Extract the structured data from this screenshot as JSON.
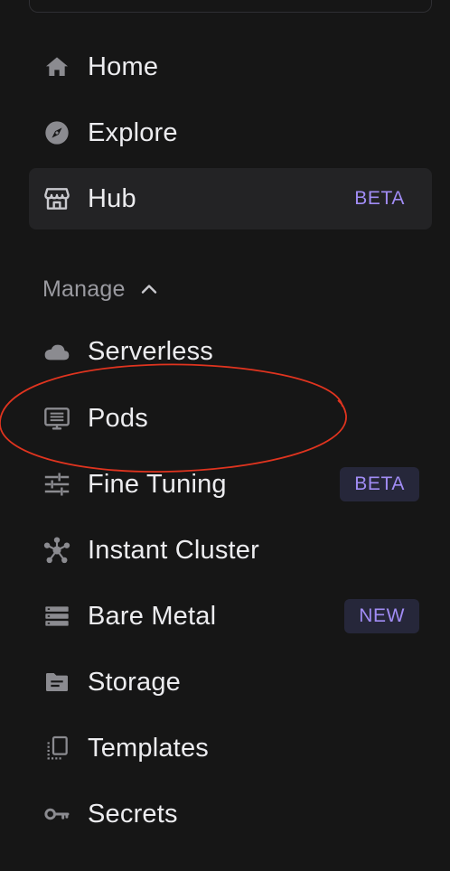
{
  "nav": {
    "home": {
      "label": "Home",
      "icon": "home-icon"
    },
    "explore": {
      "label": "Explore",
      "icon": "compass-icon"
    },
    "hub": {
      "label": "Hub",
      "icon": "storefront-icon",
      "badge": "BETA"
    }
  },
  "manage": {
    "header": "Manage",
    "header_icon": "chevron-up-icon",
    "items": [
      {
        "label": "Serverless",
        "icon": "cloud-icon"
      },
      {
        "label": "Pods",
        "icon": "monitor-icon"
      },
      {
        "label": "Fine Tuning",
        "icon": "sliders-icon",
        "badge": "BETA"
      },
      {
        "label": "Instant Cluster",
        "icon": "cluster-icon"
      },
      {
        "label": "Bare Metal",
        "icon": "server-rack-icon",
        "badge": "NEW"
      },
      {
        "label": "Storage",
        "icon": "folder-icon"
      },
      {
        "label": "Templates",
        "icon": "templates-icon"
      },
      {
        "label": "Secrets",
        "icon": "key-icon"
      }
    ]
  },
  "colors": {
    "background": "#161616",
    "active_item": "#232325",
    "badge_text": "#a18cf5",
    "badge_bg": "#26273a",
    "annotation": "#e0341f"
  }
}
